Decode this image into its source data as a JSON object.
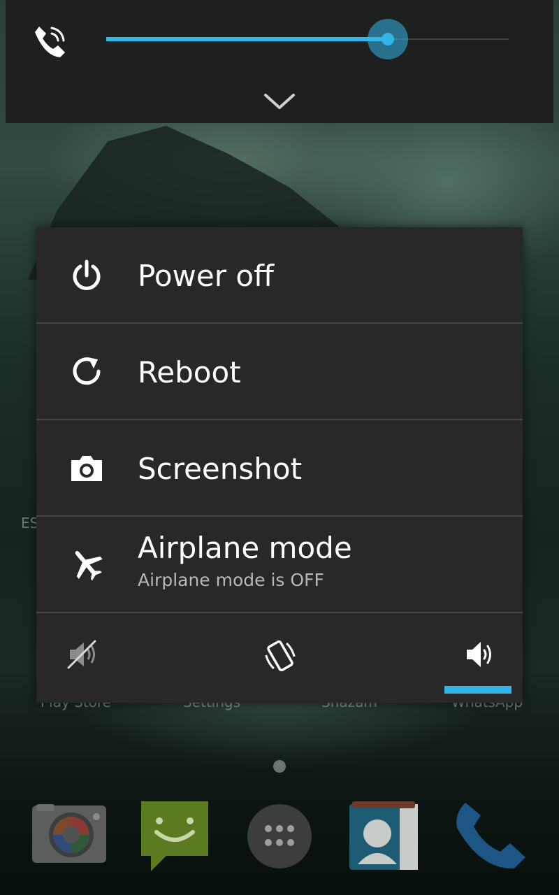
{
  "volume": {
    "stream_icon": "phone-in-call-icon",
    "level_percent": 71,
    "accent_color": "#33b5e5",
    "expand_icon": "chevron-down-icon"
  },
  "power_menu": {
    "items": [
      {
        "label": "Power off",
        "icon": "power-icon"
      },
      {
        "label": "Reboot",
        "icon": "reboot-icon"
      },
      {
        "label": "Screenshot",
        "icon": "camera-icon"
      },
      {
        "label": "Airplane mode",
        "sublabel": "Airplane mode is OFF",
        "icon": "airplane-icon"
      }
    ],
    "sound_modes": [
      {
        "name": "silent",
        "icon": "volume-muted-icon",
        "selected": false
      },
      {
        "name": "vibrate",
        "icon": "vibrate-icon",
        "selected": false
      },
      {
        "name": "sound",
        "icon": "volume-on-icon",
        "selected": true
      }
    ]
  },
  "home_screen": {
    "partial_label": "ES",
    "app_labels": [
      "Play Store",
      "Settings",
      "Shazam",
      "WhatsApp"
    ],
    "dock": [
      "camera-app-icon",
      "messaging-app-icon",
      "app-drawer-icon",
      "contacts-app-icon",
      "phone-app-icon"
    ]
  }
}
